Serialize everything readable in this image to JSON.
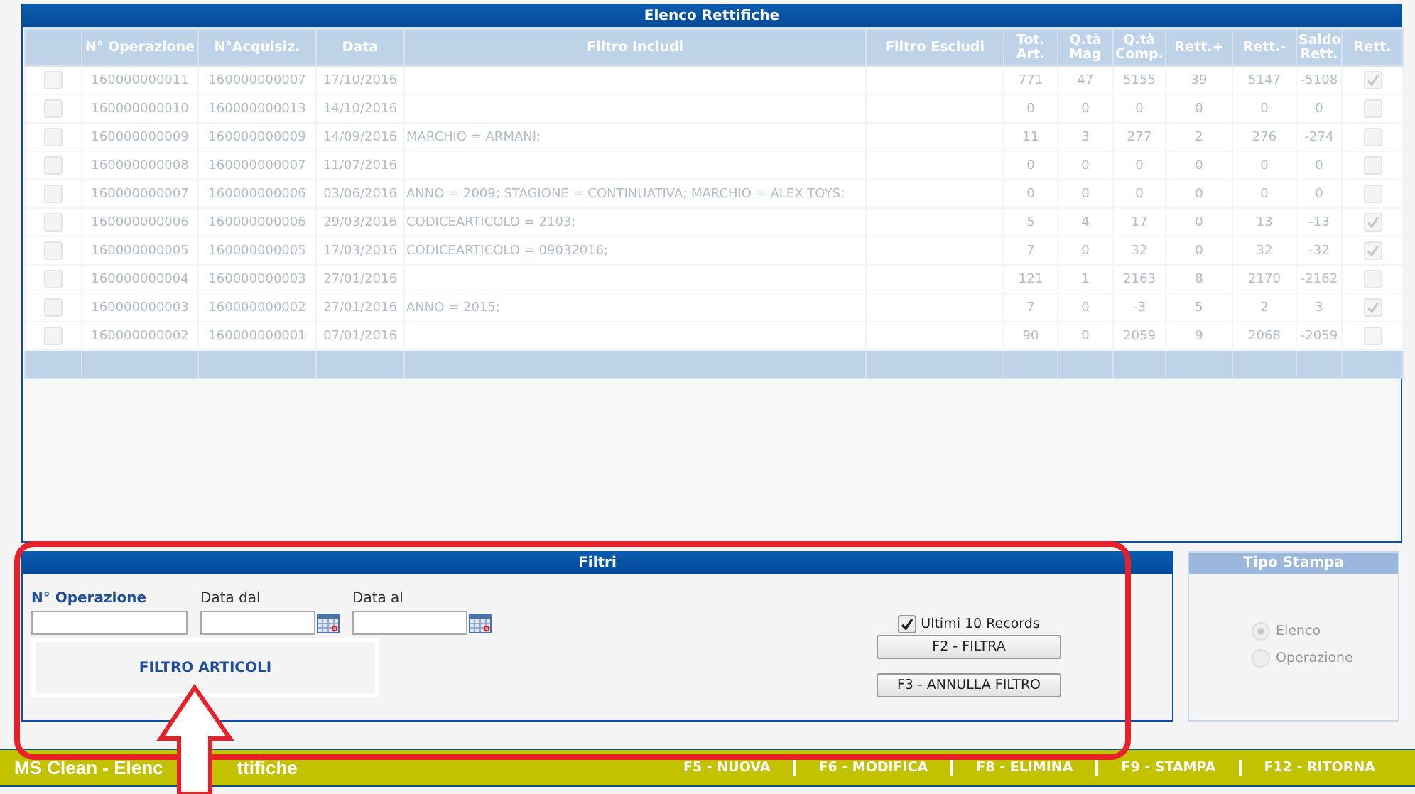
{
  "list_panel": {
    "title": "Elenco Rettifiche",
    "columns": [
      "",
      "N° Operazione",
      "N°Acquisiz.",
      "Data",
      "Filtro Includi",
      "Filtro Escludi",
      "Tot. Art.",
      "Q.tà Mag",
      "Q.tà Comp.",
      "Rett.+",
      "Rett.-",
      "Saldo Rett.",
      "Rett."
    ],
    "rows": [
      {
        "selected": false,
        "operazione": "160000000011",
        "acquisiz": "160000000007",
        "data": "17/10/2016",
        "filtro_includi": "",
        "filtro_escludi": "",
        "tot_art": "771",
        "qta_mag": "47",
        "qta_comp": "5155",
        "rett_plus": "39",
        "rett_minus": "5147",
        "saldo": "-5108",
        "rett": true
      },
      {
        "selected": false,
        "operazione": "160000000010",
        "acquisiz": "160000000013",
        "data": "14/10/2016",
        "filtro_includi": "",
        "filtro_escludi": "",
        "tot_art": "0",
        "qta_mag": "0",
        "qta_comp": "0",
        "rett_plus": "0",
        "rett_minus": "0",
        "saldo": "0",
        "rett": false
      },
      {
        "selected": false,
        "operazione": "160000000009",
        "acquisiz": "160000000009",
        "data": "14/09/2016",
        "filtro_includi": "MARCHIO = ARMANI;",
        "filtro_escludi": "",
        "tot_art": "11",
        "qta_mag": "3",
        "qta_comp": "277",
        "rett_plus": "2",
        "rett_minus": "276",
        "saldo": "-274",
        "rett": false
      },
      {
        "selected": false,
        "operazione": "160000000008",
        "acquisiz": "160000000007",
        "data": "11/07/2016",
        "filtro_includi": "",
        "filtro_escludi": "",
        "tot_art": "0",
        "qta_mag": "0",
        "qta_comp": "0",
        "rett_plus": "0",
        "rett_minus": "0",
        "saldo": "0",
        "rett": false
      },
      {
        "selected": false,
        "operazione": "160000000007",
        "acquisiz": "160000000006",
        "data": "03/06/2016",
        "filtro_includi": "ANNO = 2009; STAGIONE = CONTINUATIVA; MARCHIO = ALEX TOYS;",
        "filtro_escludi": "",
        "tot_art": "0",
        "qta_mag": "0",
        "qta_comp": "0",
        "rett_plus": "0",
        "rett_minus": "0",
        "saldo": "0",
        "rett": false
      },
      {
        "selected": false,
        "operazione": "160000000006",
        "acquisiz": "160000000006",
        "data": "29/03/2016",
        "filtro_includi": "CODICEARTICOLO = 2103;",
        "filtro_escludi": "",
        "tot_art": "5",
        "qta_mag": "4",
        "qta_comp": "17",
        "rett_plus": "0",
        "rett_minus": "13",
        "saldo": "-13",
        "rett": true
      },
      {
        "selected": false,
        "operazione": "160000000005",
        "acquisiz": "160000000005",
        "data": "17/03/2016",
        "filtro_includi": "CODICEARTICOLO = 09032016;",
        "filtro_escludi": "",
        "tot_art": "7",
        "qta_mag": "0",
        "qta_comp": "32",
        "rett_plus": "0",
        "rett_minus": "32",
        "saldo": "-32",
        "rett": true
      },
      {
        "selected": false,
        "operazione": "160000000004",
        "acquisiz": "160000000003",
        "data": "27/01/2016",
        "filtro_includi": "",
        "filtro_escludi": "",
        "tot_art": "121",
        "qta_mag": "1",
        "qta_comp": "2163",
        "rett_plus": "8",
        "rett_minus": "2170",
        "saldo": "-2162",
        "rett": false
      },
      {
        "selected": false,
        "operazione": "160000000003",
        "acquisiz": "160000000002",
        "data": "27/01/2016",
        "filtro_includi": "ANNO = 2015;",
        "filtro_escludi": "",
        "tot_art": "7",
        "qta_mag": "0",
        "qta_comp": "-3",
        "rett_plus": "5",
        "rett_minus": "2",
        "saldo": "3",
        "rett": true
      },
      {
        "selected": false,
        "operazione": "160000000002",
        "acquisiz": "160000000001",
        "data": "07/01/2016",
        "filtro_includi": "",
        "filtro_escludi": "",
        "tot_art": "90",
        "qta_mag": "0",
        "qta_comp": "2059",
        "rett_plus": "9",
        "rett_minus": "2068",
        "saldo": "-2059",
        "rett": false
      }
    ]
  },
  "filters": {
    "title": "Filtri",
    "fields": [
      {
        "label": "N° Operazione",
        "kind": "text"
      },
      {
        "label": "Data dal",
        "kind": "date"
      },
      {
        "label": "Data al",
        "kind": "date"
      }
    ],
    "filter_articles_button": "FILTRO ARTICOLI",
    "last_records": {
      "label": "Ultimi 10 Records",
      "checked": true
    },
    "buttons": [
      "F2 - FILTRA",
      "F3 - ANNULLA FILTRO"
    ]
  },
  "print_type": {
    "title": "Tipo Stampa",
    "disabled": true,
    "options": [
      {
        "label": "Elenco",
        "selected": true
      },
      {
        "label": "Operazione",
        "selected": false
      }
    ]
  },
  "status_bar": {
    "title_start": "MS Clean - Elenc",
    "title_end": "ttifiche",
    "commands": [
      "F5 - NUOVA",
      "F6 - MODIFICA",
      "F8 - ELIMINA",
      "F9 - STAMPA",
      "F12 - RITORNA"
    ]
  }
}
